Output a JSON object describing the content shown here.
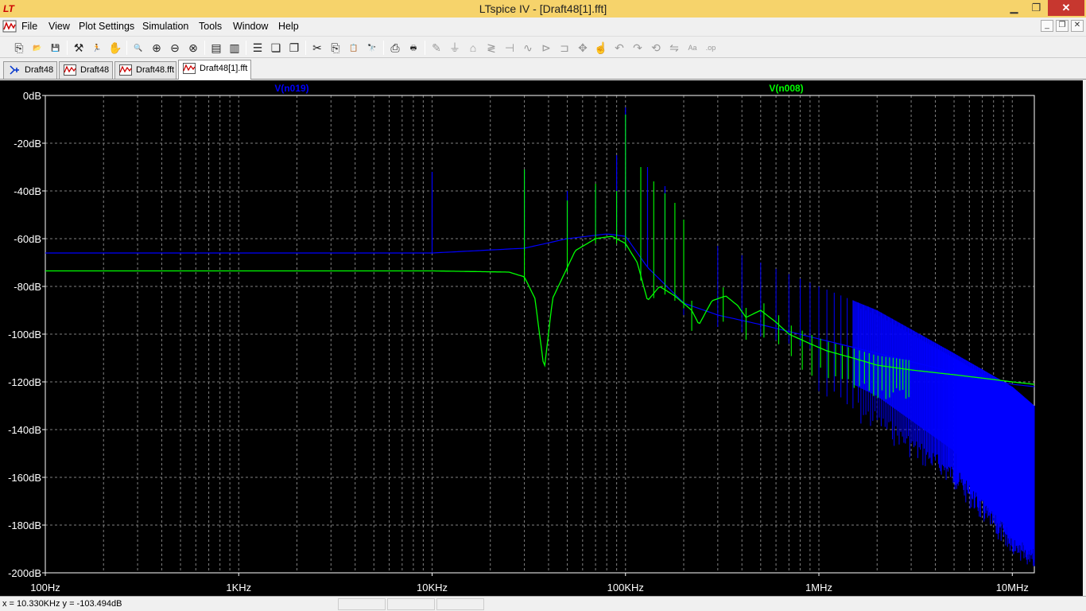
{
  "window": {
    "title": "LTspice IV - [Draft48[1].fft]",
    "logo_text": "LT",
    "min_glyph": "▁",
    "max_glyph": "❐",
    "close_glyph": "✕"
  },
  "menu": {
    "items": [
      {
        "label": "File"
      },
      {
        "label": "View"
      },
      {
        "label": "Plot Settings"
      },
      {
        "label": "Simulation"
      },
      {
        "label": "Tools"
      },
      {
        "label": "Window"
      },
      {
        "label": "Help"
      }
    ],
    "mdi_min": "_",
    "mdi_restore": "❐",
    "mdi_close": "✕"
  },
  "toolbar": {
    "icons": [
      {
        "name": "new-schematic-icon",
        "glyph": "⎘"
      },
      {
        "name": "open-icon",
        "glyph": "📂"
      },
      {
        "name": "save-icon",
        "glyph": "💾"
      },
      {
        "name": "control-panel-icon",
        "glyph": "⚒"
      },
      {
        "name": "run-icon",
        "glyph": "🏃"
      },
      {
        "name": "halt-icon",
        "glyph": "✋"
      },
      {
        "name": "zoom-area-icon",
        "glyph": "🔍"
      },
      {
        "name": "pan-icon",
        "glyph": "⊕"
      },
      {
        "name": "zoom-out-icon",
        "glyph": "⊖"
      },
      {
        "name": "zoom-cancel-icon",
        "glyph": "⊗"
      },
      {
        "name": "autorange-icon",
        "glyph": "▤"
      },
      {
        "name": "fit-icon",
        "glyph": "▥"
      },
      {
        "name": "tile-horizontal-icon",
        "glyph": "☰"
      },
      {
        "name": "cascade-icon",
        "glyph": "❏"
      },
      {
        "name": "tile-vertical-icon",
        "glyph": "❐"
      },
      {
        "name": "cut-icon",
        "glyph": "✂"
      },
      {
        "name": "copy-icon",
        "glyph": "⎘"
      },
      {
        "name": "paste-icon",
        "glyph": "📋"
      },
      {
        "name": "find-icon",
        "glyph": "🔭"
      },
      {
        "name": "print-setup-icon",
        "glyph": "⎙"
      },
      {
        "name": "print-icon",
        "glyph": "🖶"
      },
      {
        "name": "wire-icon",
        "glyph": "✎"
      },
      {
        "name": "ground-icon",
        "glyph": "⏚"
      },
      {
        "name": "label-net-icon",
        "glyph": "⌂"
      },
      {
        "name": "resistor-icon",
        "glyph": "≷"
      },
      {
        "name": "capacitor-icon",
        "glyph": "⊣"
      },
      {
        "name": "inductor-icon",
        "glyph": "∿"
      },
      {
        "name": "diode-icon",
        "glyph": "⊳"
      },
      {
        "name": "component-icon",
        "glyph": "⊐"
      },
      {
        "name": "move-icon",
        "glyph": "✥"
      },
      {
        "name": "drag-icon",
        "glyph": "☝"
      },
      {
        "name": "undo-icon",
        "glyph": "↶"
      },
      {
        "name": "redo-icon",
        "glyph": "↷"
      },
      {
        "name": "rotate-icon",
        "glyph": "⟲"
      },
      {
        "name": "mirror-icon",
        "glyph": "⇋"
      },
      {
        "name": "text-icon",
        "glyph": "Aa"
      },
      {
        "name": "spice-directive-icon",
        "glyph": ".op"
      }
    ]
  },
  "tabs": [
    {
      "label": "Draft48",
      "icon": "schematic-icon",
      "active": false
    },
    {
      "label": "Draft48",
      "icon": "waveform-icon",
      "active": false
    },
    {
      "label": "Draft48.fft",
      "icon": "waveform-icon",
      "active": false
    },
    {
      "label": "Draft48[1].fft",
      "icon": "waveform-icon",
      "active": true
    }
  ],
  "chart_data": {
    "type": "line",
    "title": "",
    "xscale": "log",
    "xlim_hz": [
      100,
      13000000
    ],
    "ylim_db": [
      -200,
      0
    ],
    "grid": true,
    "x_ticks": [
      {
        "value": 100,
        "label": "100Hz"
      },
      {
        "value": 1000,
        "label": "1KHz"
      },
      {
        "value": 10000,
        "label": "10KHz"
      },
      {
        "value": 100000,
        "label": "100KHz"
      },
      {
        "value": 1000000,
        "label": "1MHz"
      },
      {
        "value": 10000000,
        "label": "10MHz"
      }
    ],
    "y_ticks": [
      {
        "value": 0,
        "label": "0dB"
      },
      {
        "value": -20,
        "label": "-20dB"
      },
      {
        "value": -40,
        "label": "-40dB"
      },
      {
        "value": -60,
        "label": "-60dB"
      },
      {
        "value": -80,
        "label": "-80dB"
      },
      {
        "value": -100,
        "label": "-100dB"
      },
      {
        "value": -120,
        "label": "-120dB"
      },
      {
        "value": -140,
        "label": "-140dB"
      },
      {
        "value": -160,
        "label": "-160dB"
      },
      {
        "value": -180,
        "label": "-180dB"
      },
      {
        "value": -200,
        "label": "-200dB"
      }
    ],
    "series": [
      {
        "name": "V(n019)",
        "color": "#0000ff",
        "baseline": [
          [
            100,
            -66
          ],
          [
            1000,
            -66
          ],
          [
            10000,
            -66
          ],
          [
            30000,
            -64
          ],
          [
            50000,
            -60
          ],
          [
            80000,
            -58
          ],
          [
            100000,
            -59
          ],
          [
            130000,
            -72
          ],
          [
            200000,
            -87
          ],
          [
            300000,
            -92
          ],
          [
            500000,
            -96
          ],
          [
            1000000,
            -102
          ],
          [
            2000000,
            -108
          ],
          [
            5000000,
            -116
          ],
          [
            10000000,
            -121
          ],
          [
            13000000,
            -122
          ]
        ],
        "upper_envelope": [
          [
            100000,
            -35
          ],
          [
            150000,
            -50
          ],
          [
            200000,
            -58
          ],
          [
            300000,
            -63
          ],
          [
            500000,
            -70
          ],
          [
            1000000,
            -80
          ],
          [
            2000000,
            -90
          ],
          [
            5000000,
            -108
          ],
          [
            10000000,
            -122
          ],
          [
            13000000,
            -130
          ]
        ],
        "lower_envelope": [
          [
            1000000,
            -120
          ],
          [
            2000000,
            -132
          ],
          [
            5000000,
            -155
          ],
          [
            8000000,
            -175
          ],
          [
            13000000,
            -190
          ]
        ],
        "spikes": [
          [
            10000,
            -32
          ],
          [
            30000,
            -31
          ],
          [
            50000,
            -40
          ],
          [
            70000,
            -38
          ],
          [
            90000,
            -25
          ],
          [
            100000,
            -5
          ],
          [
            130000,
            -30
          ],
          [
            160000,
            -38
          ]
        ]
      },
      {
        "name": "V(n008)",
        "color": "#00ff00",
        "points": [
          [
            100,
            -73.5
          ],
          [
            1000,
            -73.5
          ],
          [
            10000,
            -73.5
          ],
          [
            25000,
            -74
          ],
          [
            30000,
            -76
          ],
          [
            34000,
            -85
          ],
          [
            38000,
            -115
          ],
          [
            42000,
            -85
          ],
          [
            55000,
            -65
          ],
          [
            70000,
            -60
          ],
          [
            85000,
            -59
          ],
          [
            100000,
            -62
          ],
          [
            115000,
            -70
          ],
          [
            130000,
            -86
          ],
          [
            150000,
            -80
          ],
          [
            180000,
            -84
          ],
          [
            220000,
            -90
          ],
          [
            240000,
            -96
          ],
          [
            280000,
            -86
          ],
          [
            330000,
            -84
          ],
          [
            380000,
            -88
          ],
          [
            420000,
            -93
          ],
          [
            500000,
            -90
          ],
          [
            600000,
            -95
          ],
          [
            700000,
            -100
          ],
          [
            900000,
            -104
          ],
          [
            1100000,
            -107
          ],
          [
            1500000,
            -110
          ],
          [
            2000000,
            -113
          ],
          [
            3000000,
            -115
          ],
          [
            5000000,
            -117
          ],
          [
            8000000,
            -119
          ],
          [
            10000000,
            -120
          ],
          [
            13000000,
            -121
          ]
        ],
        "spikes": [
          [
            30000,
            -31
          ],
          [
            50000,
            -44
          ],
          [
            70000,
            -37
          ],
          [
            90000,
            -40
          ],
          [
            100000,
            -8
          ],
          [
            120000,
            -30
          ],
          [
            140000,
            -36
          ],
          [
            160000,
            -41
          ],
          [
            180000,
            -45
          ],
          [
            200000,
            -52
          ]
        ]
      }
    ]
  },
  "status": {
    "readout": "x = 10.330KHz   y = -103.494dB"
  }
}
